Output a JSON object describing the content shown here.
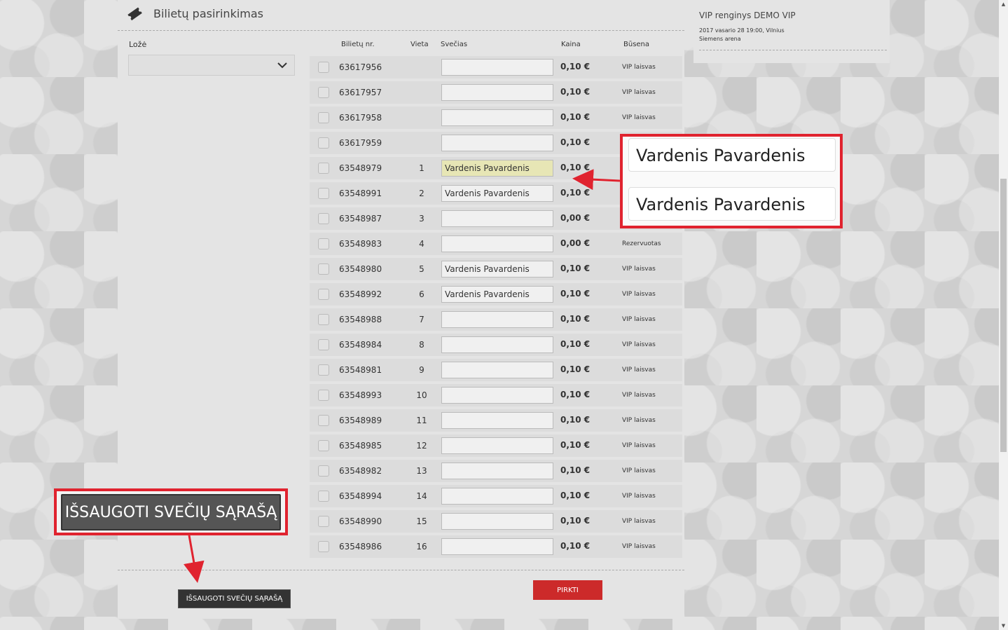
{
  "header": {
    "title": "Bilietų pasirinkimas",
    "icon": "ticket-icon"
  },
  "loze": {
    "label": "Ložė",
    "value": ""
  },
  "columns": {
    "ticket_no": "Bilietų nr.",
    "seat": "Vieta",
    "guest": "Svečias",
    "price": "Kaina",
    "status": "Būsena"
  },
  "rows": [
    {
      "ticket": "63617956",
      "seat": "",
      "guest": "",
      "price": "0,10 €",
      "status": "VIP laisvas"
    },
    {
      "ticket": "63617957",
      "seat": "",
      "guest": "",
      "price": "0,10 €",
      "status": "VIP laisvas"
    },
    {
      "ticket": "63617958",
      "seat": "",
      "guest": "",
      "price": "0,10 €",
      "status": "VIP laisvas"
    },
    {
      "ticket": "63617959",
      "seat": "",
      "guest": "",
      "price": "0,10 €",
      "status": ""
    },
    {
      "ticket": "63548979",
      "seat": "1",
      "guest": "Vardenis Pavardenis",
      "price": "0,10 €",
      "status": "",
      "highlight": true
    },
    {
      "ticket": "63548991",
      "seat": "2",
      "guest": "Vardenis Pavardenis",
      "price": "0,10 €",
      "status": ""
    },
    {
      "ticket": "63548987",
      "seat": "3",
      "guest": "",
      "price": "0,00 €",
      "status": ""
    },
    {
      "ticket": "63548983",
      "seat": "4",
      "guest": "",
      "price": "0,00 €",
      "status": "Rezervuotas"
    },
    {
      "ticket": "63548980",
      "seat": "5",
      "guest": "Vardenis Pavardenis",
      "price": "0,10 €",
      "status": "VIP laisvas"
    },
    {
      "ticket": "63548992",
      "seat": "6",
      "guest": "Vardenis Pavardenis",
      "price": "0,10 €",
      "status": "VIP laisvas"
    },
    {
      "ticket": "63548988",
      "seat": "7",
      "guest": "",
      "price": "0,10 €",
      "status": "VIP laisvas"
    },
    {
      "ticket": "63548984",
      "seat": "8",
      "guest": "",
      "price": "0,10 €",
      "status": "VIP laisvas"
    },
    {
      "ticket": "63548981",
      "seat": "9",
      "guest": "",
      "price": "0,10 €",
      "status": "VIP laisvas"
    },
    {
      "ticket": "63548993",
      "seat": "10",
      "guest": "",
      "price": "0,10 €",
      "status": "VIP laisvas"
    },
    {
      "ticket": "63548989",
      "seat": "11",
      "guest": "",
      "price": "0,10 €",
      "status": "VIP laisvas"
    },
    {
      "ticket": "63548985",
      "seat": "12",
      "guest": "",
      "price": "0,10 €",
      "status": "VIP laisvas"
    },
    {
      "ticket": "63548982",
      "seat": "13",
      "guest": "",
      "price": "0,10 €",
      "status": "VIP laisvas"
    },
    {
      "ticket": "63548994",
      "seat": "14",
      "guest": "",
      "price": "0,10 €",
      "status": "VIP laisvas"
    },
    {
      "ticket": "63548990",
      "seat": "15",
      "guest": "",
      "price": "0,10 €",
      "status": "VIP laisvas"
    },
    {
      "ticket": "63548986",
      "seat": "16",
      "guest": "",
      "price": "0,10 €",
      "status": "VIP laisvas"
    }
  ],
  "buttons": {
    "save": "IŠSAUGOTI SVEČIŲ SĄRAŠĄ",
    "buy": "PIRKTI"
  },
  "event": {
    "title": "VIP renginys DEMO VIP",
    "datetime": "2017 vasario 28 19:00, Vilnius",
    "venue": "Siemens arena"
  },
  "callouts": {
    "names": [
      "Vardenis Pavardenis",
      "Vardenis Pavardenis"
    ],
    "save": "IŠSAUGOTI SVEČIŲ SĄRAŠĄ"
  },
  "colors": {
    "callout": "#e0232f",
    "buy": "#cc2a2a",
    "highlight": "#e7e6b5"
  }
}
